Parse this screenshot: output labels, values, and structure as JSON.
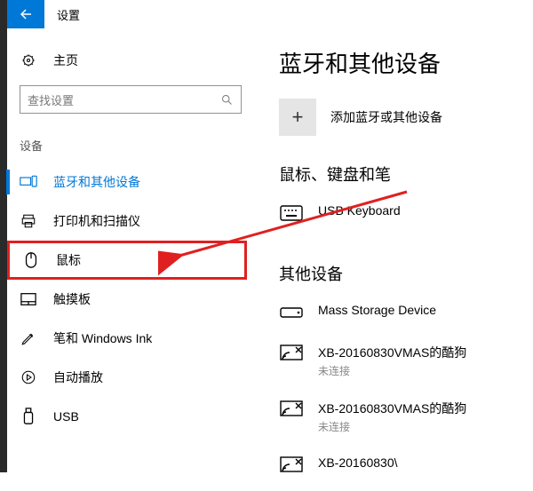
{
  "titlebar": {
    "title": "设置"
  },
  "sidebar": {
    "home": "主页",
    "search_placeholder": "查找设置",
    "section_label": "设备",
    "items": [
      {
        "label": "蓝牙和其他设备"
      },
      {
        "label": "打印机和扫描仪"
      },
      {
        "label": "鼠标"
      },
      {
        "label": "触摸板"
      },
      {
        "label": "笔和 Windows Ink"
      },
      {
        "label": "自动播放"
      },
      {
        "label": "USB"
      }
    ]
  },
  "main": {
    "heading": "蓝牙和其他设备",
    "add_label": "添加蓝牙或其他设备",
    "section1": "鼠标、键盘和笔",
    "keyboard": "USB Keyboard",
    "section2": "其他设备",
    "devices": [
      {
        "name": "Mass Storage Device",
        "status": ""
      },
      {
        "name": "XB-20160830VMAS的酷狗",
        "status": "未连接"
      },
      {
        "name": "XB-20160830VMAS的酷狗",
        "status": "未连接"
      },
      {
        "name": "XB-20160830\\",
        "status": ""
      }
    ]
  },
  "colors": {
    "accent": "#0078d7",
    "annotation": "#e02020"
  }
}
